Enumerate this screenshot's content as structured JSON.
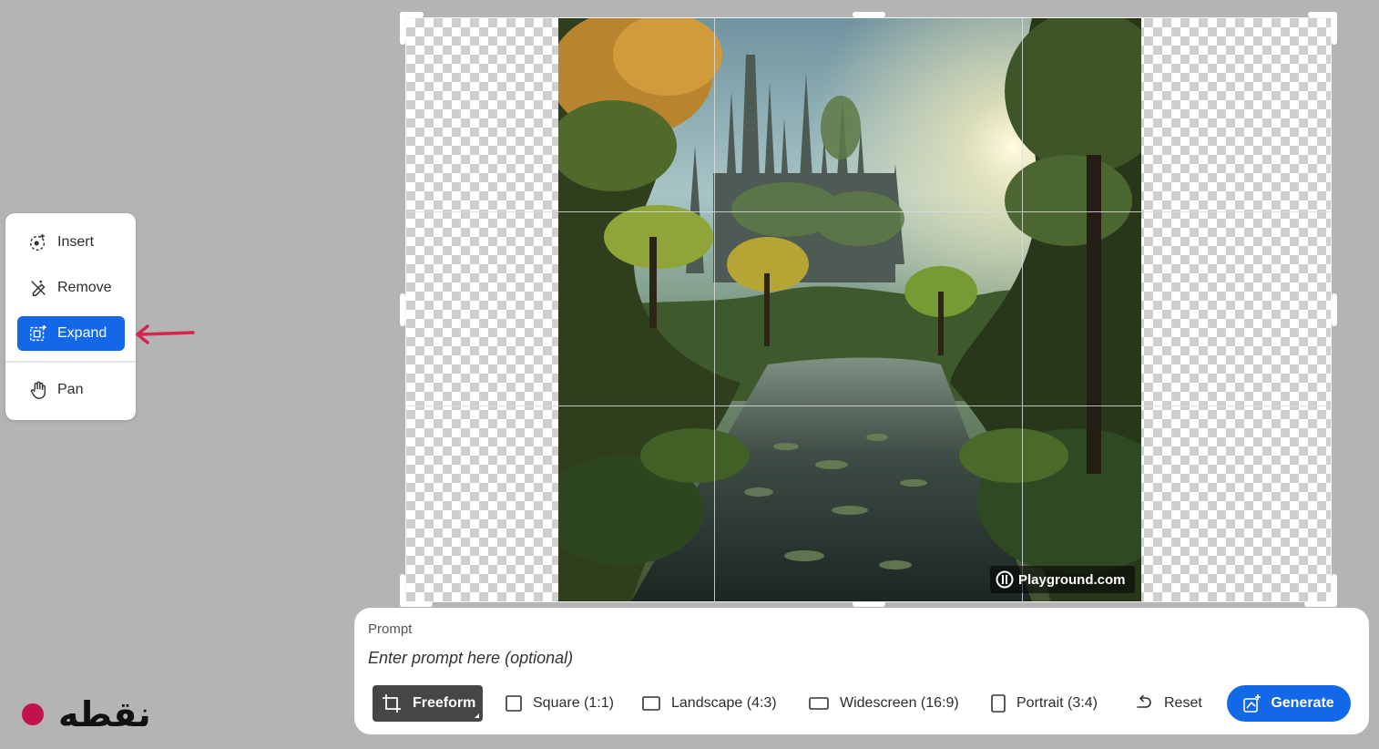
{
  "tools": {
    "insert_label": "Insert",
    "remove_label": "Remove",
    "expand_label": "Expand",
    "pan_label": "Pan",
    "active": "Expand"
  },
  "canvas": {
    "watermark_text": "Playground.com",
    "background": "transparent-checkerboard"
  },
  "prompt": {
    "label": "Prompt",
    "placeholder": "Enter prompt here (optional)",
    "value": ""
  },
  "aspect_options": {
    "freeform": "Freeform",
    "square": "Square (1:1)",
    "landscape": "Landscape (4:3)",
    "widescreen": "Widescreen (16:9)",
    "portrait": "Portrait (3:4)",
    "selected": "Freeform"
  },
  "actions": {
    "reset_label": "Reset",
    "generate_label": "Generate"
  },
  "brand": {
    "text": "نقطه"
  },
  "colors": {
    "accent": "#1268e6",
    "brand_dot": "#c0134c",
    "annotation_arrow": "#d2264f",
    "selected_option_bg": "#464646"
  },
  "icons": [
    "insert-icon",
    "remove-icon",
    "expand-icon",
    "pan-icon",
    "crop-icon",
    "square-icon",
    "landscape-icon",
    "widescreen-icon",
    "portrait-icon",
    "reset-icon",
    "generate-icon",
    "playground-logo-icon"
  ]
}
